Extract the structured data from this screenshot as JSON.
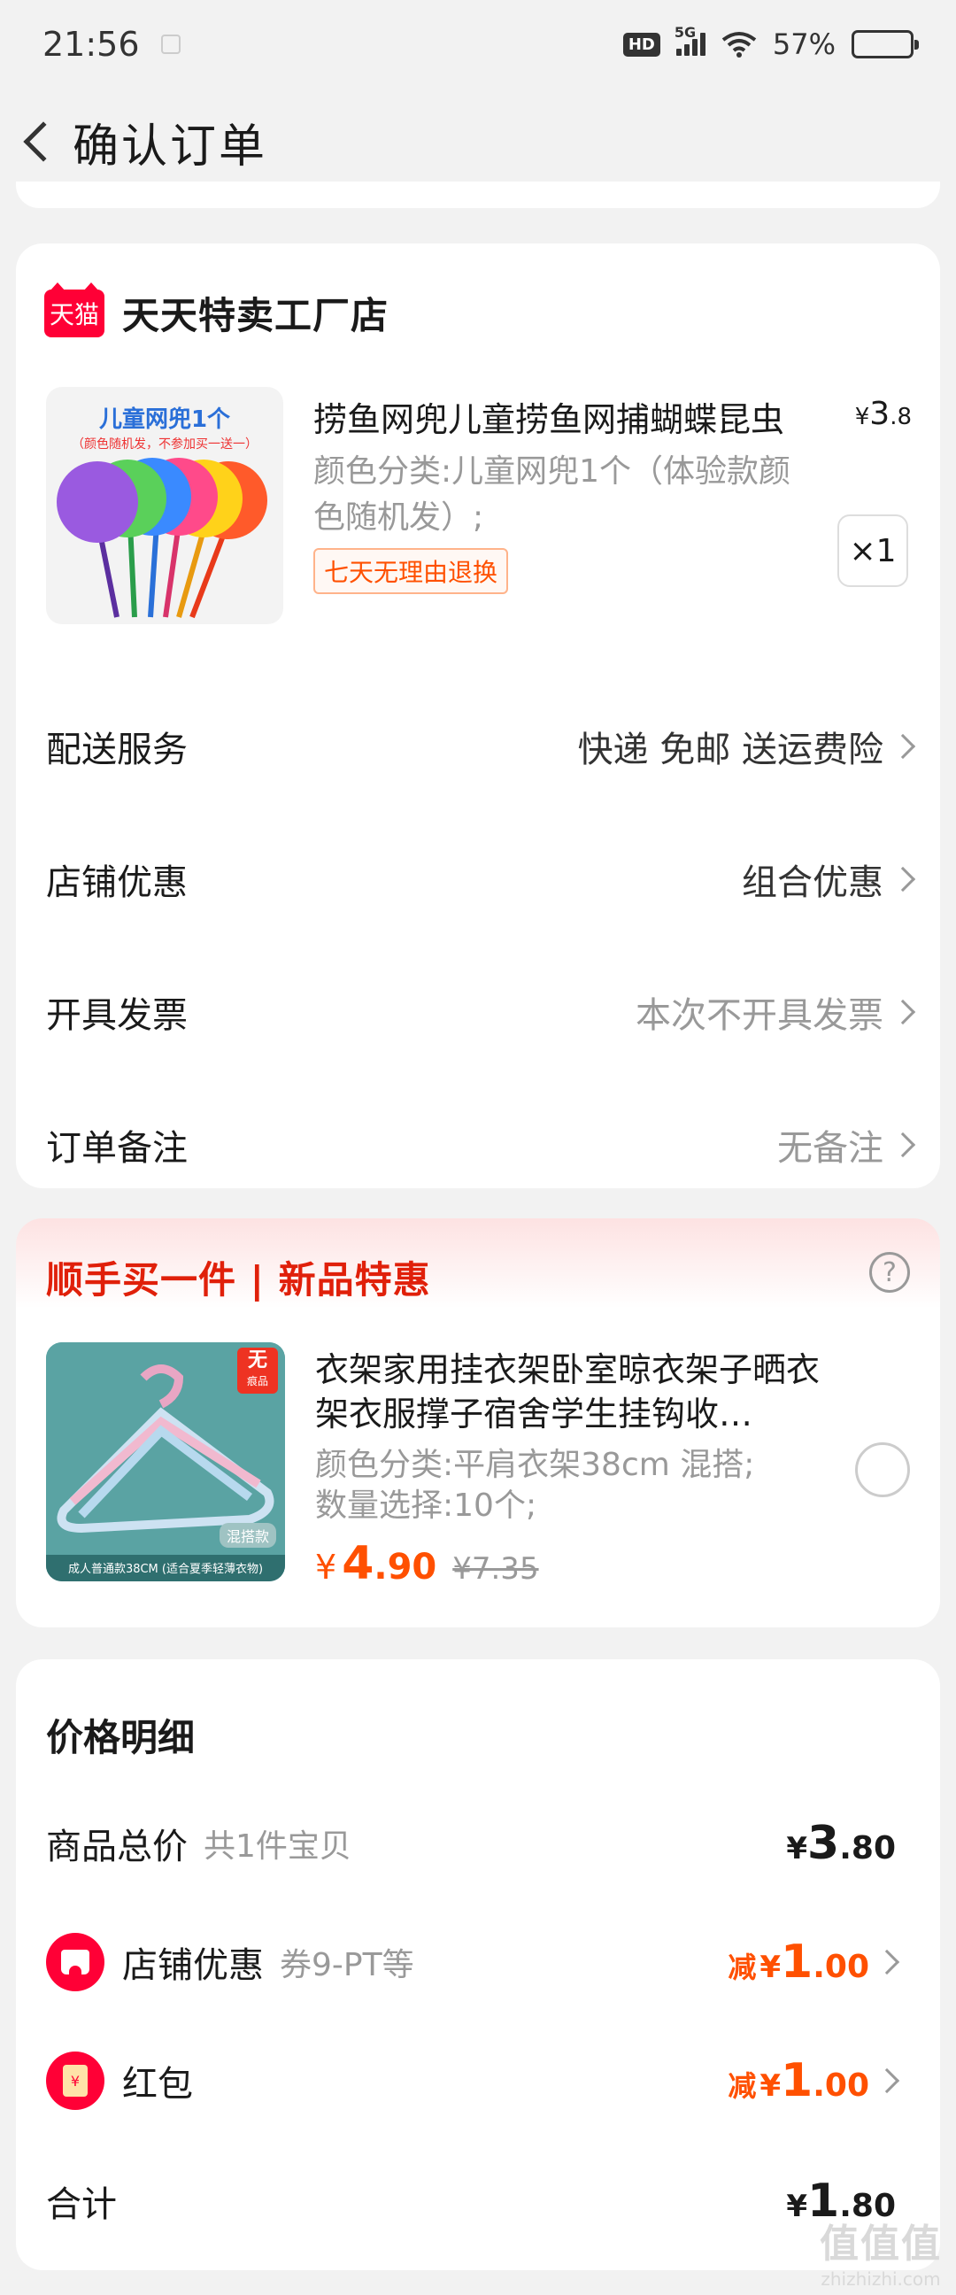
{
  "status_bar": {
    "time": "21:56",
    "hd": "HD",
    "network": "5G",
    "battery_percent": "57%",
    "battery_level": 0.57
  },
  "header": {
    "title": "确认订单"
  },
  "store": {
    "name": "天天特卖工厂店",
    "logo_text": "天猫",
    "product": {
      "image_title": "儿童网兜1个",
      "image_subtitle": "（颜色随机发，不参加买一送一）",
      "title": "捞鱼网兜儿童捞鱼网捕蝴蝶昆虫",
      "price_symbol": "¥",
      "price_int": "3",
      "price_dec": ".8",
      "spec": "颜色分类:儿童网兜1个（体验款颜色随机发）;",
      "return_tag": "七天无理由退换",
      "qty": "×1"
    },
    "options": [
      {
        "label": "配送服务",
        "value": "快递 免邮 送运费险"
      },
      {
        "label": "店铺优惠",
        "value": "组合优惠"
      },
      {
        "label": "开具发票",
        "value": "本次不开具发票"
      },
      {
        "label": "订单备注",
        "value": "无备注"
      }
    ]
  },
  "addon": {
    "title": "顺手买一件 | 新品特惠",
    "help": "?",
    "product": {
      "badge_top": "无",
      "badge_bottom": "痕品",
      "image_tag": "混搭款",
      "image_caption": "成人普通款38CM (适合夏季轻薄衣物)",
      "name": "衣架家用挂衣架卧室晾衣架子晒衣架衣服撑子宿舍学生挂钩收…",
      "spec_line1": "颜色分类:平肩衣架38cm 混搭;",
      "spec_line2": "数量选择:10个;",
      "price_symbol": "¥",
      "price_int": "4",
      "price_dec": ".90",
      "orig_price": "¥7.35"
    }
  },
  "price_detail": {
    "title": "价格明细",
    "goods_total": {
      "label": "商品总价",
      "sub": "共1件宝贝",
      "symbol": "¥",
      "int": "3",
      "dec": ".80"
    },
    "store_discount": {
      "label": "店铺优惠",
      "sub": "券9-PT等",
      "prefix": "减",
      "symbol": "¥",
      "int": "1",
      "dec": ".00"
    },
    "red_packet": {
      "label": "红包",
      "icon_text": "¥",
      "prefix": "减",
      "symbol": "¥",
      "int": "1",
      "dec": ".00"
    },
    "total": {
      "label": "合计",
      "symbol": "¥",
      "int": "1",
      "dec": ".80"
    }
  },
  "watermark": {
    "big": "值值值",
    "small": "zhizhizhi.com"
  },
  "colors": {
    "accent_red": "#ff0036",
    "price_orange": "#ff5000",
    "addon_title_red": "#e0200a",
    "muted_gray": "#999999"
  }
}
